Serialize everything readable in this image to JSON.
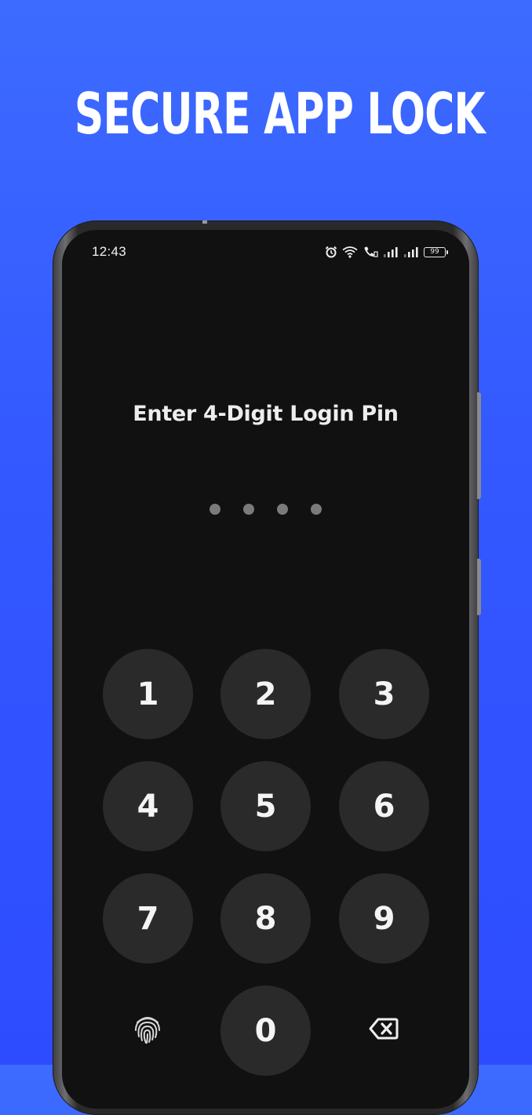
{
  "promo": {
    "title": "SECURE APP LOCK"
  },
  "status_bar": {
    "time": "12:43",
    "battery_level": "99",
    "icons": [
      "alarm-icon",
      "wifi-icon",
      "call-icon",
      "signal-icon",
      "signal-icon",
      "battery-icon"
    ]
  },
  "lock_screen": {
    "prompt": "Enter 4-Digit Login Pin",
    "pin_length": 4,
    "pin_entered": 0,
    "keys": {
      "k1": "1",
      "k2": "2",
      "k3": "3",
      "k4": "4",
      "k5": "5",
      "k6": "6",
      "k7": "7",
      "k8": "8",
      "k9": "9",
      "k0": "0"
    },
    "left_action_icon": "fingerprint-icon",
    "right_action_icon": "backspace-icon"
  },
  "colors": {
    "background_top": "#3d6bff",
    "background_bottom": "#2d4cff",
    "screen_background": "#111111",
    "key_background": "#2a2a2a",
    "pin_dot": "#7b7b7b",
    "text": "#ededed"
  }
}
